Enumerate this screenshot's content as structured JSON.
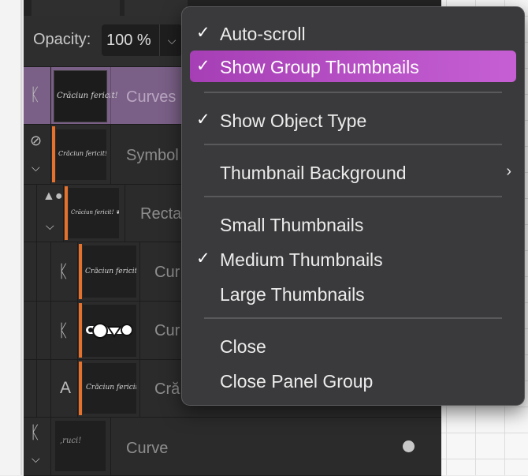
{
  "panel": {
    "opacity_label": "Opacity:",
    "opacity_value": "100 %"
  },
  "layers": [
    {
      "name": "Curves",
      "icon": "curve-icon",
      "thumb_text": "Crăciun fericit!",
      "selected": true
    },
    {
      "name": "Symbol",
      "icon": "symbol-icon",
      "thumb_text": "Crăciun fericit! ❦❦"
    },
    {
      "name": "Recta",
      "icon": "shapes-icon",
      "thumb_text": "Crăciun fericit! ❦❦"
    },
    {
      "name": "Cur",
      "icon": "curve-icon",
      "thumb_text": "Crăciun fericit!"
    },
    {
      "name": "Cur",
      "icon": "curve-icon",
      "thumb_text": ""
    },
    {
      "name": "Cră",
      "icon": "text-icon",
      "icon_glyph": "A",
      "thumb_text": "Crăciun fericit!"
    },
    {
      "name": "Curve",
      "icon": "curve-icon",
      "thumb_text": ",ruci!"
    }
  ],
  "menu": {
    "items": [
      {
        "label": "Auto-scroll",
        "checked": true
      },
      {
        "label": "Show Group Thumbnails",
        "checked": true,
        "highlighted": true
      },
      {
        "label": "Show Object Type",
        "checked": true
      },
      {
        "label": "Thumbnail Background",
        "submenu": true
      },
      {
        "label": "Small Thumbnails"
      },
      {
        "label": "Medium Thumbnails",
        "checked": true
      },
      {
        "label": "Large Thumbnails"
      },
      {
        "label": "Close"
      },
      {
        "label": "Close Panel Group"
      }
    ],
    "check_glyph": "✓",
    "submenu_glyph": "›"
  }
}
